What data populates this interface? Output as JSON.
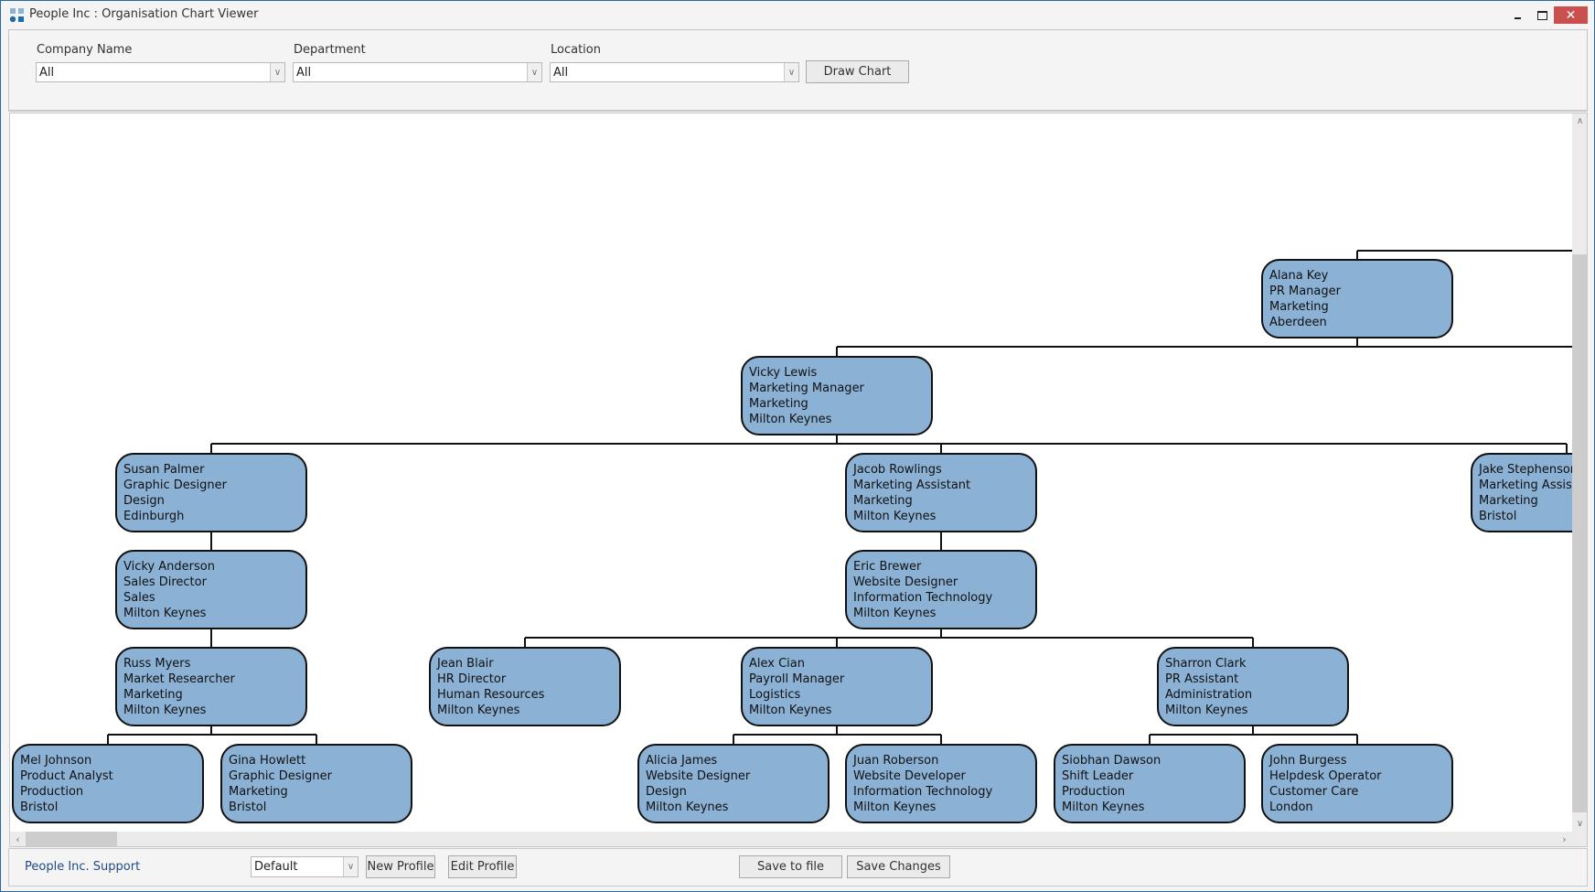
{
  "window": {
    "title": "People Inc : Organisation Chart Viewer",
    "controls": {
      "minimize": "minimize",
      "maximize": "maximize",
      "close": "✕"
    }
  },
  "filters": {
    "company": {
      "label": "Company Name",
      "value": "All"
    },
    "department": {
      "label": "Department",
      "value": "All"
    },
    "location": {
      "label": "Location",
      "value": "All"
    },
    "draw_button": "Draw Chart"
  },
  "colors": {
    "node_fill": "#8bb1d5",
    "node_border": "#111111",
    "connector": "#111111",
    "close_button": "#c9504e",
    "link": "#1f4a86"
  },
  "org_chart": {
    "nodes": [
      {
        "id": "alana",
        "name": "Alana Key",
        "title": "PR Manager",
        "department": "Marketing",
        "location": "Aberdeen"
      },
      {
        "id": "vickyl",
        "name": "Vicky Lewis",
        "title": "Marketing Manager",
        "department": "Marketing",
        "location": "Milton Keynes"
      },
      {
        "id": "susan",
        "name": "Susan Palmer",
        "title": "Graphic Designer",
        "department": "Design",
        "location": "Edinburgh"
      },
      {
        "id": "jacob",
        "name": "Jacob Rowlings",
        "title": "Marketing Assistant",
        "department": "Marketing",
        "location": "Milton Keynes"
      },
      {
        "id": "jake",
        "name": "Jake Stephenson",
        "title": "Marketing Assistant",
        "department": "Marketing",
        "location": "Bristol"
      },
      {
        "id": "vickya",
        "name": "Vicky Anderson",
        "title": "Sales Director",
        "department": "Sales",
        "location": "Milton Keynes"
      },
      {
        "id": "eric",
        "name": "Eric Brewer",
        "title": "Website Designer",
        "department": "Information Technology",
        "location": "Milton Keynes"
      },
      {
        "id": "russ",
        "name": "Russ Myers",
        "title": "Market Researcher",
        "department": "Marketing",
        "location": "Milton Keynes"
      },
      {
        "id": "jean",
        "name": "Jean Blair",
        "title": "HR Director",
        "department": "Human Resources",
        "location": "Milton Keynes"
      },
      {
        "id": "alex",
        "name": "Alex Cian",
        "title": "Payroll Manager",
        "department": "Logistics",
        "location": "Milton Keynes"
      },
      {
        "id": "sharron",
        "name": "Sharron Clark",
        "title": "PR Assistant",
        "department": "Administration",
        "location": "Milton Keynes"
      },
      {
        "id": "mel",
        "name": "Mel Johnson",
        "title": "Product Analyst",
        "department": "Production",
        "location": "Bristol"
      },
      {
        "id": "gina",
        "name": "Gina Howlett",
        "title": "Graphic Designer",
        "department": "Marketing",
        "location": "Bristol"
      },
      {
        "id": "alicia",
        "name": "Alicia James",
        "title": "Website Designer",
        "department": "Design",
        "location": "Milton Keynes"
      },
      {
        "id": "juan",
        "name": "Juan Roberson",
        "title": "Website Developer",
        "department": "Information Technology",
        "location": "Milton Keynes"
      },
      {
        "id": "siobhan",
        "name": "Siobhan Dawson",
        "title": "Shift Leader",
        "department": "Production",
        "location": "Milton Keynes"
      },
      {
        "id": "john",
        "name": "John Burgess",
        "title": "Helpdesk Operator",
        "department": "Customer Care",
        "location": "London"
      }
    ],
    "reports_to": {
      "vickyl": "alana",
      "susan": "vickyl",
      "jacob": "vickyl",
      "jake": "vickyl",
      "vickya": "susan",
      "russ": "vickya",
      "mel": "russ",
      "gina": "russ",
      "eric": "jacob",
      "jean": "eric",
      "alex": "eric",
      "sharron": "eric",
      "alicia": "alex",
      "juan": "alex",
      "siobhan": "sharron",
      "john": "sharron"
    }
  },
  "footer": {
    "support_link": "People Inc. Support",
    "profile": {
      "value": "Default"
    },
    "new_profile": "New Profile",
    "edit_profile": "Edit Profile",
    "save_to_file": "Save to file",
    "save_changes": "Save Changes"
  }
}
